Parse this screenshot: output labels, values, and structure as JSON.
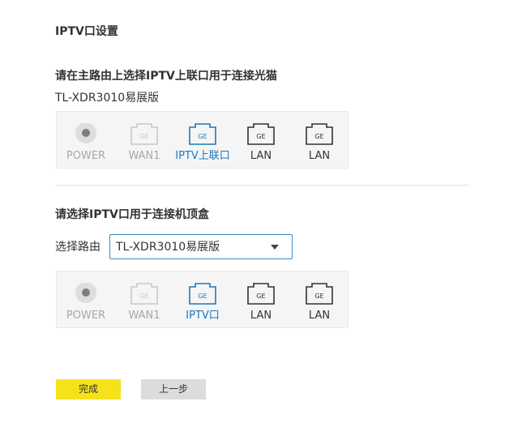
{
  "page": {
    "title": "IPTV口设置"
  },
  "section1": {
    "title": "请在主路由上选择IPTV上联口用于连接光猫",
    "model": "TL-XDR3010易展版",
    "ports": [
      {
        "label": "POWER",
        "icon": "power-icon",
        "state": "muted"
      },
      {
        "label": "WAN1",
        "icon": "ethernet-port-icon",
        "state": "muted",
        "badge": "GE"
      },
      {
        "label": "IPTV上联口",
        "icon": "ethernet-port-icon",
        "state": "active",
        "badge": "GE"
      },
      {
        "label": "LAN",
        "icon": "ethernet-port-icon",
        "state": "normal",
        "badge": "GE"
      },
      {
        "label": "LAN",
        "icon": "ethernet-port-icon",
        "state": "normal",
        "badge": "GE"
      }
    ]
  },
  "section2": {
    "title": "请选择IPTV口用于连接机顶盒",
    "select_label": "选择路由",
    "select_value": "TL-XDR3010易展版",
    "ports": [
      {
        "label": "POWER",
        "icon": "power-icon",
        "state": "muted"
      },
      {
        "label": "WAN1",
        "icon": "ethernet-port-icon",
        "state": "muted",
        "badge": "GE"
      },
      {
        "label": "IPTV口",
        "icon": "ethernet-port-icon",
        "state": "active",
        "badge": "GE"
      },
      {
        "label": "LAN",
        "icon": "ethernet-port-icon",
        "state": "normal",
        "badge": "GE"
      },
      {
        "label": "LAN",
        "icon": "ethernet-port-icon",
        "state": "normal",
        "badge": "GE"
      }
    ]
  },
  "buttons": {
    "finish": "完成",
    "previous": "上一步"
  },
  "colors": {
    "active": "#1a78c2",
    "muted": "#a8a8a8",
    "normal": "#333333",
    "primary_button": "#f6e21a",
    "secondary_button": "#dcdcdc"
  }
}
